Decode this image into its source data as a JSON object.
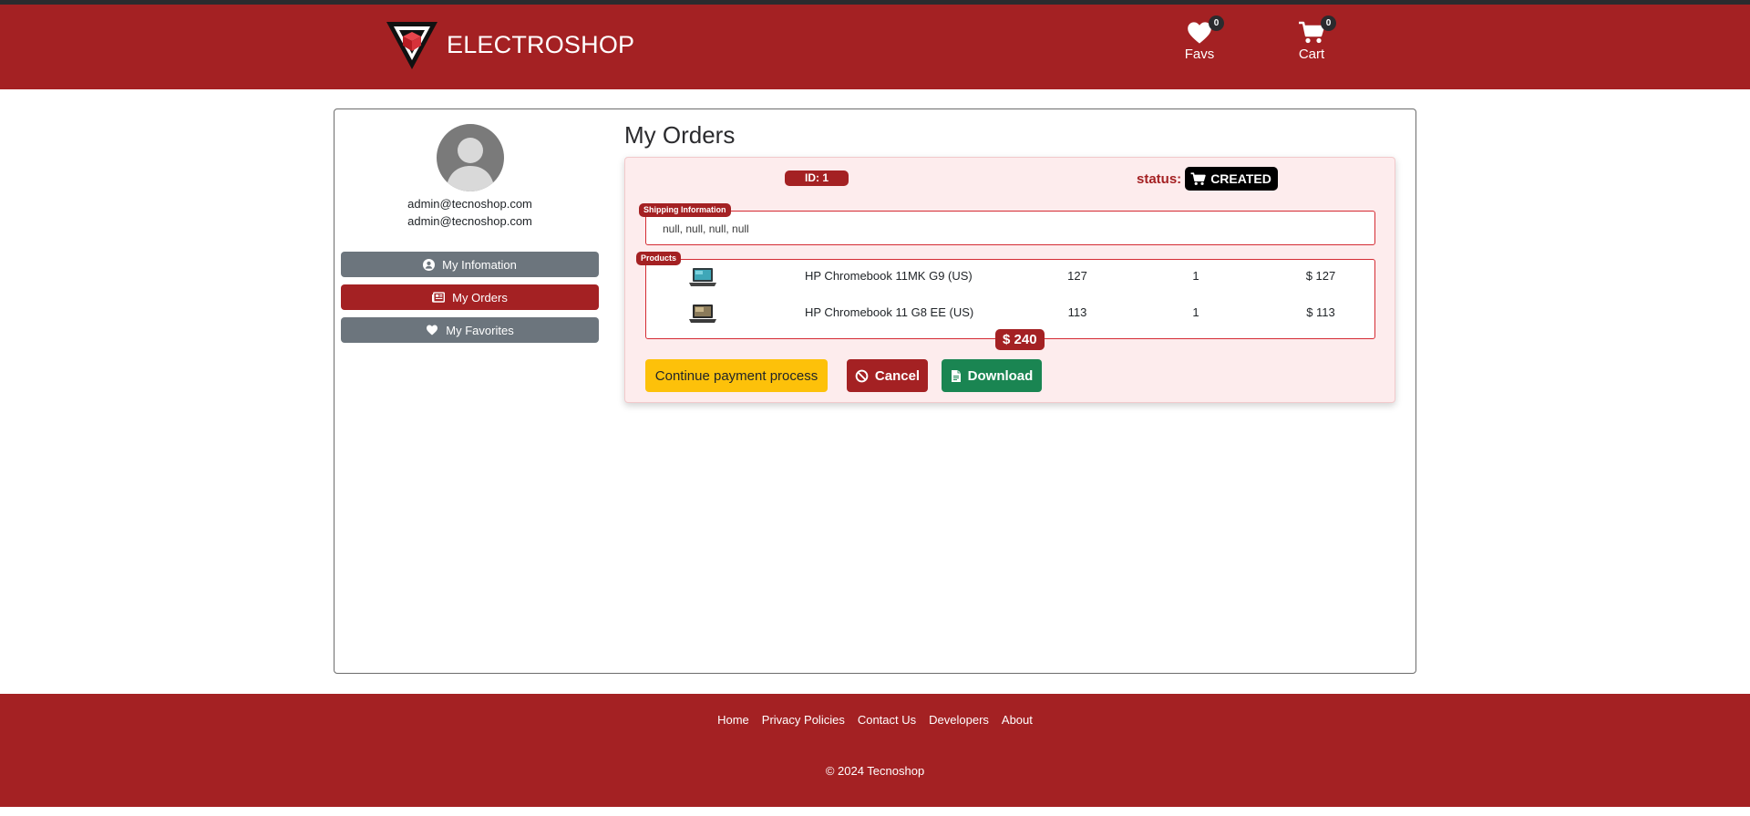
{
  "colors": {
    "brand": "#a42123",
    "dark": "#2b2b2e",
    "card_bg": "#fdeced",
    "warning": "#fdc10a",
    "success": "#1a8552",
    "secondary": "#6c757d"
  },
  "header": {
    "brand_name": "ELECTROSHOP",
    "favs": {
      "label": "Favs",
      "count": "0",
      "icon": "heart-icon"
    },
    "cart": {
      "label": "Cart",
      "count": "0",
      "icon": "cart-icon"
    }
  },
  "sidebar": {
    "emails": [
      "admin@tecnoshop.com",
      "admin@tecnoshop.com"
    ],
    "items": [
      {
        "label": "My Infomation",
        "icon": "user-circle-icon"
      },
      {
        "label": "My Orders",
        "icon": "newspaper-icon"
      },
      {
        "label": "My Favorites",
        "icon": "heart-icon"
      }
    ]
  },
  "orders": {
    "title": "My Orders",
    "order": {
      "id_label": "ID: 1",
      "status_label": "status:",
      "status_value": "CREATED",
      "shipping_legend": "Shipping Information",
      "shipping_text": "null, null, null, null",
      "products_legend": "Products",
      "products": [
        {
          "name": "HP Chromebook 11MK G9 (US)",
          "price": "127",
          "qty": "1",
          "subtotal": "$ 127"
        },
        {
          "name": "HP Chromebook 11 G8 EE (US)",
          "price": "113",
          "qty": "1",
          "subtotal": "$ 113"
        }
      ],
      "total": "$ 240",
      "buttons": {
        "continue": "Continue payment process",
        "cancel": "Cancel",
        "download": "Download"
      }
    }
  },
  "footer": {
    "links": [
      "Home",
      "Privacy Policies",
      "Contact Us",
      "Developers",
      "About"
    ],
    "copyright": "© 2024 Tecnoshop"
  }
}
